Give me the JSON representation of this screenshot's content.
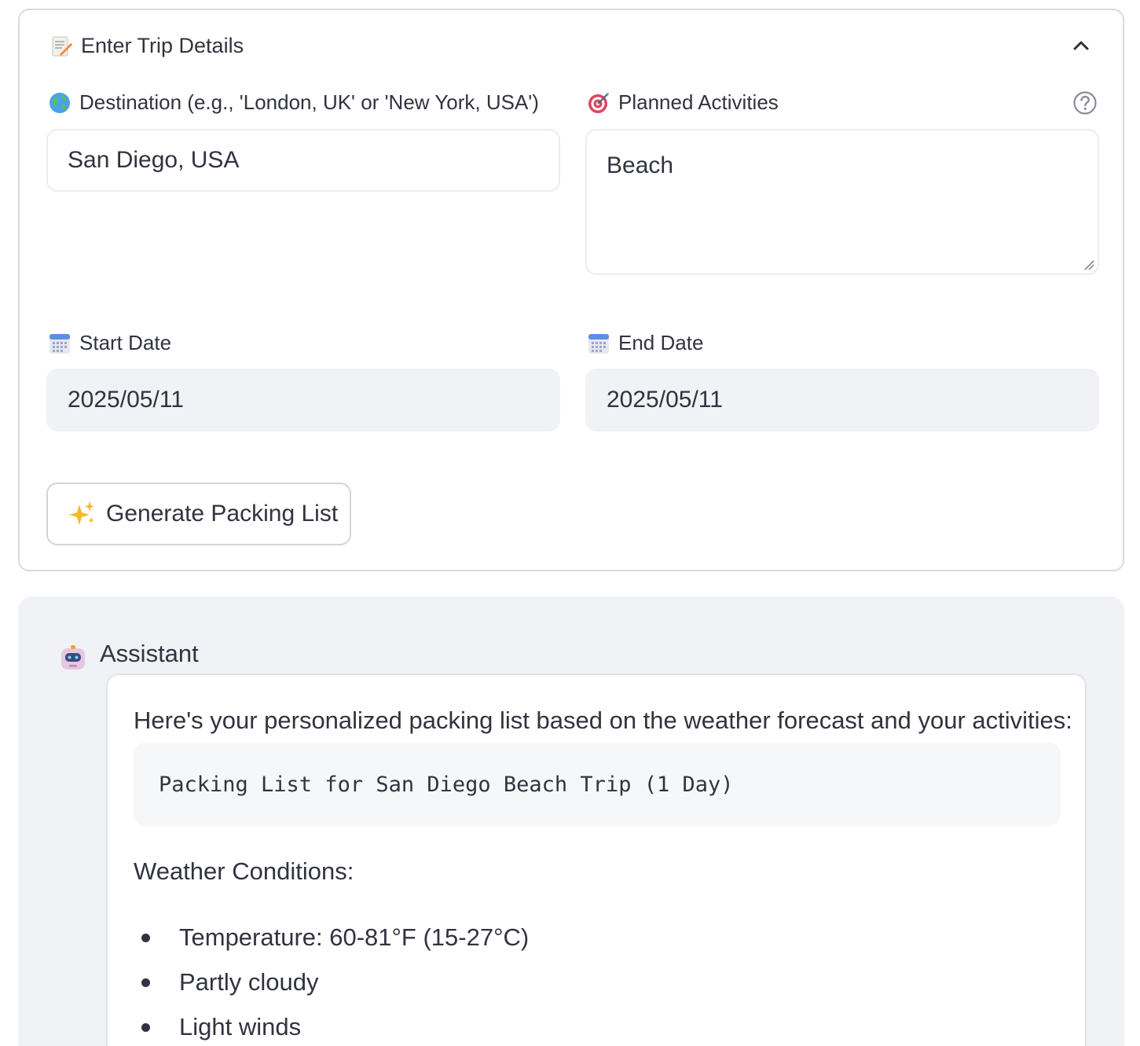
{
  "expander": {
    "title": "Enter Trip Details",
    "destination": {
      "label": "Destination (e.g., 'London, UK' or 'New York, USA')",
      "value": "San Diego, USA"
    },
    "activities": {
      "label": "Planned Activities",
      "value": "Beach"
    },
    "start_date": {
      "label": "Start Date",
      "value": "2025/05/11"
    },
    "end_date": {
      "label": "End Date",
      "value": "2025/05/11"
    },
    "generate_button": "Generate Packing List"
  },
  "chat": {
    "role": "Assistant",
    "intro": "Here's your personalized packing list based on the weather forecast and your activities:",
    "code": "Packing List for San Diego Beach Trip (1 Day)",
    "weather_heading": "Weather Conditions:",
    "weather_items": [
      "Temperature: 60-81°F (15-27°C)",
      "Partly cloudy",
      "Light winds"
    ]
  },
  "icons": {
    "memo": "memo-icon",
    "globe": "globe-icon",
    "target": "target-icon",
    "calendar": "calendar-icon",
    "sparkles": "sparkles-icon",
    "robot": "robot-icon",
    "chevron": "chevron-up-icon",
    "help": "help-icon"
  }
}
